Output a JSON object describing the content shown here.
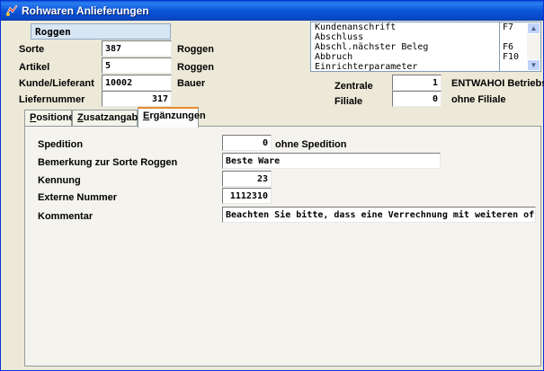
{
  "window": {
    "title": "Rohwaren Anlieferungen",
    "titlebar_color": "#0a55d8"
  },
  "header": {
    "name_value": "Roggen"
  },
  "fields": {
    "sorte": {
      "label": "Sorte",
      "value": "387",
      "suffix": "Roggen"
    },
    "artikel": {
      "label": "Artikel",
      "value": "5",
      "suffix": "Roggen"
    },
    "kunde": {
      "label": "Kunde/Lieferant",
      "value": "10002",
      "suffix": "Bauer"
    },
    "liefernummer": {
      "label": "Liefernummer",
      "value": "317"
    },
    "zentrale": {
      "label": "Zentrale",
      "value": "1",
      "suffix": "ENTWAHOI Betriebsst"
    },
    "filiale": {
      "label": "Filiale",
      "value": "0",
      "suffix": "ohne Filiale"
    }
  },
  "menu_list": {
    "items": [
      {
        "label": "Kundenanschrift",
        "key": "F7"
      },
      {
        "label": "Abschluss",
        "key": ""
      },
      {
        "label": "Abschl.nächster Beleg",
        "key": "F6"
      },
      {
        "label": "Abbruch",
        "key": "F10"
      },
      {
        "label": "Einrichterparameter",
        "key": ""
      }
    ],
    "scroll_up": "up-arrow-icon",
    "scroll_down": "down-arrow-icon"
  },
  "tabs": [
    {
      "label_u": "P",
      "label_rest": "ositionen",
      "active": false
    },
    {
      "label_u": "Z",
      "label_rest": "usatzangaben",
      "active": false
    },
    {
      "label_u": "E",
      "label_rest": "rgänzungen",
      "active": true
    }
  ],
  "ergaenzungen": {
    "spedition": {
      "label": "Spedition",
      "value": "0",
      "suffix": "ohne Spedition"
    },
    "bemerkung": {
      "label": "Bemerkung zur Sorte Roggen",
      "value": "Beste Ware"
    },
    "kennung": {
      "label": "Kennung",
      "value": "23"
    },
    "externe_nummer": {
      "label": "Externe Nummer",
      "value": "1112310"
    },
    "kommentar": {
      "label": "Kommentar",
      "value": "Beachten Sie bitte, dass eine Verrechnung mit weiteren off"
    }
  }
}
